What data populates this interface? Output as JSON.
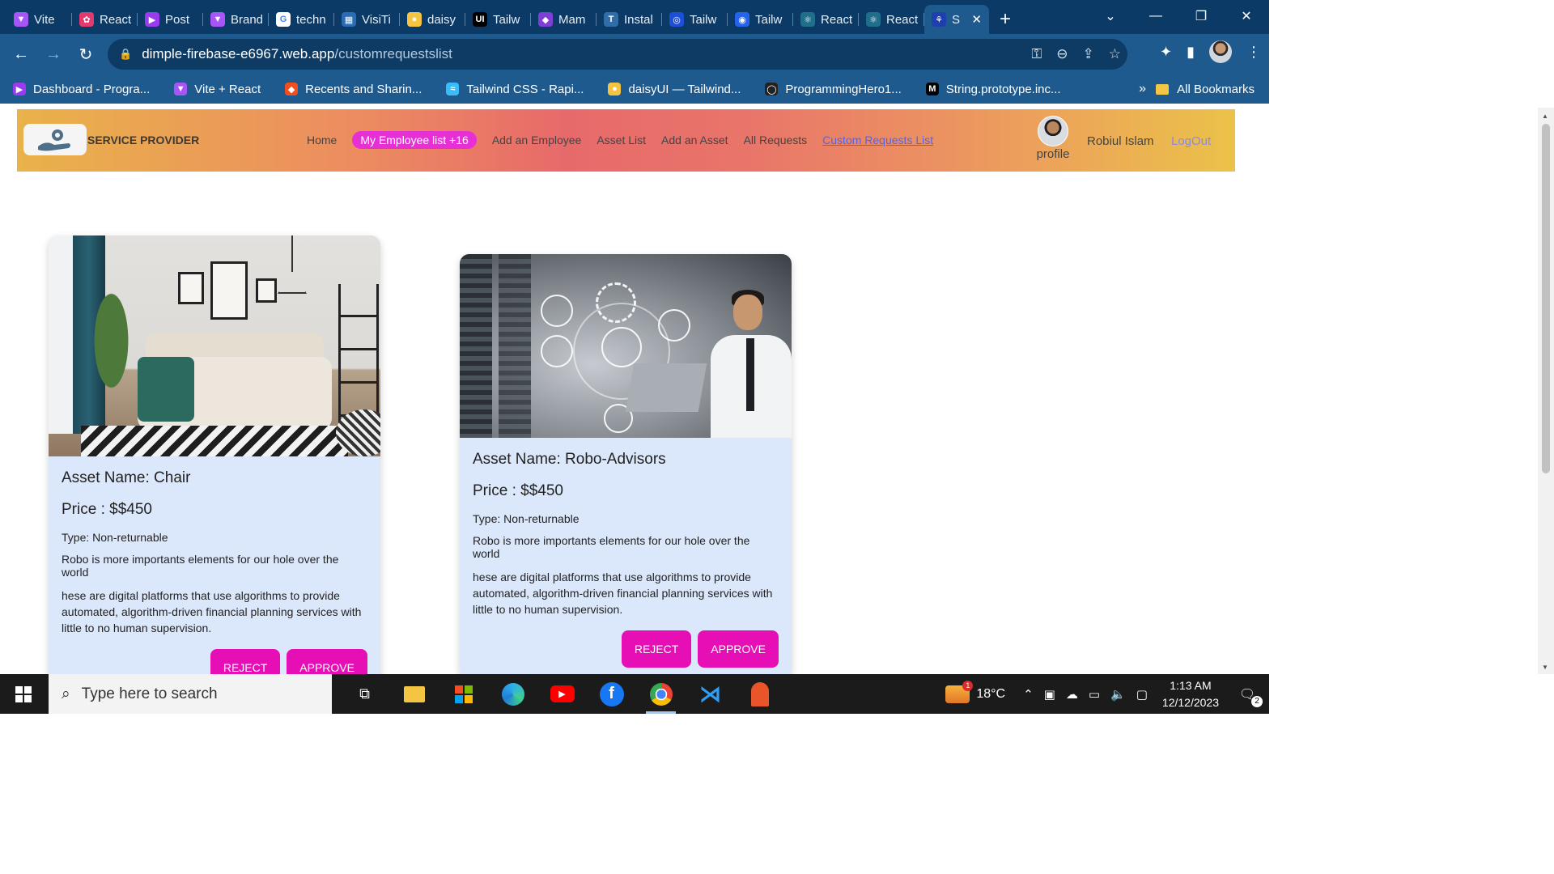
{
  "browser": {
    "tabs": [
      {
        "label": "Vite",
        "color": "#a855f7",
        "glyph": "▼"
      },
      {
        "label": "React",
        "color": "#e23a6e",
        "glyph": "✿"
      },
      {
        "label": "Post",
        "color": "#9b3bf0",
        "glyph": "▶"
      },
      {
        "label": "Brand",
        "color": "#a855f7",
        "glyph": "▼"
      },
      {
        "label": "techn",
        "color": "#ffffff",
        "glyph": "G"
      },
      {
        "label": "VisiTi",
        "color": "#2b6bb3",
        "glyph": "▦"
      },
      {
        "label": "daisy",
        "color": "#f5c542",
        "glyph": "●"
      },
      {
        "label": "Tailw",
        "color": "#000000",
        "glyph": "UI"
      },
      {
        "label": "Mam",
        "color": "#7e3fd6",
        "glyph": "◆"
      },
      {
        "label": "Instal",
        "color": "#2f6ea8",
        "glyph": "T"
      },
      {
        "label": "Tailw",
        "color": "#1d4ed8",
        "glyph": "◎"
      },
      {
        "label": "Tailw",
        "color": "#2563eb",
        "glyph": "◉"
      },
      {
        "label": "React",
        "color": "#1f6f8b",
        "glyph": "⚛"
      },
      {
        "label": "React",
        "color": "#1f6f8b",
        "glyph": "⚛"
      },
      {
        "label": "S",
        "color": "#1e40af",
        "glyph": "⚘",
        "active": true
      }
    ],
    "new_tab": "+",
    "url_host": "dimple-firebase-e6967.web.app",
    "url_path": "/customrequestslist",
    "bookmarks": [
      {
        "label": "Dashboard - Progra...",
        "color": "#9b3bf0",
        "glyph": "▶"
      },
      {
        "label": "Vite + React",
        "color": "#a855f7",
        "glyph": "▼"
      },
      {
        "label": "Recents and Sharin...",
        "color": "#f24e1e",
        "glyph": "◆"
      },
      {
        "label": "Tailwind CSS - Rapi...",
        "color": "#38bdf8",
        "glyph": "≈"
      },
      {
        "label": "daisyUI — Tailwind...",
        "color": "#f5c542",
        "glyph": "●"
      },
      {
        "label": "ProgrammingHero1...",
        "color": "#222222",
        "glyph": "◯"
      },
      {
        "label": "String.prototype.inc...",
        "color": "#000000",
        "glyph": "M"
      }
    ],
    "bookmarks_more": "»",
    "all_bookmarks": "All Bookmarks"
  },
  "site": {
    "brand": "SERVICE PROVIDER",
    "menu": {
      "home": "Home",
      "employee_list": "My Employee list +16",
      "add_employee": "Add an Employee",
      "asset_list": "Asset List",
      "add_asset": "Add an Asset",
      "all_requests": "All Requests",
      "custom_requests": "Custom Requests List"
    },
    "profile_label": "profile",
    "user_name": "Robiul Islam",
    "logout": "LogOut"
  },
  "cards": [
    {
      "name": "Asset Name: Chair",
      "price": "Price : $$450",
      "type": "Type: Non-returnable",
      "line1": "Robo is more importants elements for our hole over the world",
      "desc": "hese are digital platforms that use algorithms to provide automated, algorithm-driven financial planning services with little to no human supervision.",
      "reject": "REJECT",
      "approve": "APPROVE"
    },
    {
      "name": "Asset Name: Robo-Advisors",
      "price": "Price : $$450",
      "type": "Type: Non-returnable",
      "line1": "Robo is more importants elements for our hole over the world",
      "desc": "hese are digital platforms that use algorithms to provide automated, algorithm-driven financial planning services with little to no human supervision.",
      "reject": "REJECT",
      "approve": "APPROVE"
    }
  ],
  "taskbar": {
    "search_placeholder": "Type here to search",
    "temperature": "18°C",
    "weather_badge": "1",
    "time": "1:13 AM",
    "date": "12/12/2023",
    "notifications": "2"
  }
}
